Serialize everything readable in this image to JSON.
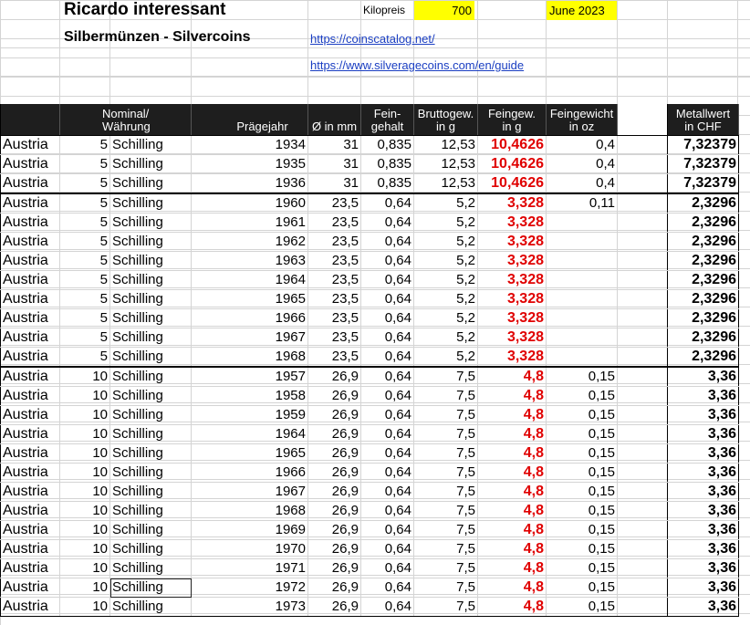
{
  "header": {
    "title": "Ricardo interessant",
    "subtitle": "Silbermünzen - Silvercoins",
    "kilopreis_label": "Kilopreis",
    "kilopreis_value": "700",
    "date": "June 2023",
    "link1": "https://coinscatalog.net/",
    "link2": "https://www.silveragecoins.com/en/guide"
  },
  "columns": {
    "c1": "",
    "c2": "Nominal/\nWährung",
    "c3": "",
    "c4": "Prägejahr",
    "c5": "Ø in mm",
    "c6": "Fein-\ngehalt",
    "c7": "Bruttogew.\nin g",
    "c8": "Feingew.\nin g",
    "c9": "Feingewicht\nin oz",
    "c10": "",
    "c11": "Metallwert\nin CHF"
  },
  "rows": [
    {
      "country": "Austria",
      "nominal": "5",
      "currency": "Schilling",
      "year": "1934",
      "diameter": "31",
      "fineness": "0,835",
      "gross": "12,53",
      "fine": "10,4626",
      "oz": "0,4",
      "value": "7,32379"
    },
    {
      "country": "Austria",
      "nominal": "5",
      "currency": "Schilling",
      "year": "1935",
      "diameter": "31",
      "fineness": "0,835",
      "gross": "12,53",
      "fine": "10,4626",
      "oz": "0,4",
      "value": "7,32379"
    },
    {
      "country": "Austria",
      "nominal": "5",
      "currency": "Schilling",
      "year": "1936",
      "diameter": "31",
      "fineness": "0,835",
      "gross": "12,53",
      "fine": "10,4626",
      "oz": "0,4",
      "value": "7,32379"
    },
    {
      "country": "Austria",
      "nominal": "5",
      "currency": "Schilling",
      "year": "1960",
      "diameter": "23,5",
      "fineness": "0,64",
      "gross": "5,2",
      "fine": "3,328",
      "oz": "0,11",
      "value": "2,3296"
    },
    {
      "country": "Austria",
      "nominal": "5",
      "currency": "Schilling",
      "year": "1961",
      "diameter": "23,5",
      "fineness": "0,64",
      "gross": "5,2",
      "fine": "3,328",
      "oz": "",
      "value": "2,3296"
    },
    {
      "country": "Austria",
      "nominal": "5",
      "currency": "Schilling",
      "year": "1962",
      "diameter": "23,5",
      "fineness": "0,64",
      "gross": "5,2",
      "fine": "3,328",
      "oz": "",
      "value": "2,3296"
    },
    {
      "country": "Austria",
      "nominal": "5",
      "currency": "Schilling",
      "year": "1963",
      "diameter": "23,5",
      "fineness": "0,64",
      "gross": "5,2",
      "fine": "3,328",
      "oz": "",
      "value": "2,3296"
    },
    {
      "country": "Austria",
      "nominal": "5",
      "currency": "Schilling",
      "year": "1964",
      "diameter": "23,5",
      "fineness": "0,64",
      "gross": "5,2",
      "fine": "3,328",
      "oz": "",
      "value": "2,3296"
    },
    {
      "country": "Austria",
      "nominal": "5",
      "currency": "Schilling",
      "year": "1965",
      "diameter": "23,5",
      "fineness": "0,64",
      "gross": "5,2",
      "fine": "3,328",
      "oz": "",
      "value": "2,3296"
    },
    {
      "country": "Austria",
      "nominal": "5",
      "currency": "Schilling",
      "year": "1966",
      "diameter": "23,5",
      "fineness": "0,64",
      "gross": "5,2",
      "fine": "3,328",
      "oz": "",
      "value": "2,3296"
    },
    {
      "country": "Austria",
      "nominal": "5",
      "currency": "Schilling",
      "year": "1967",
      "diameter": "23,5",
      "fineness": "0,64",
      "gross": "5,2",
      "fine": "3,328",
      "oz": "",
      "value": "2,3296"
    },
    {
      "country": "Austria",
      "nominal": "5",
      "currency": "Schilling",
      "year": "1968",
      "diameter": "23,5",
      "fineness": "0,64",
      "gross": "5,2",
      "fine": "3,328",
      "oz": "",
      "value": "2,3296"
    },
    {
      "country": "Austria",
      "nominal": "10",
      "currency": "Schilling",
      "year": "1957",
      "diameter": "26,9",
      "fineness": "0,64",
      "gross": "7,5",
      "fine": "4,8",
      "oz": "0,15",
      "value": "3,36"
    },
    {
      "country": "Austria",
      "nominal": "10",
      "currency": "Schilling",
      "year": "1958",
      "diameter": "26,9",
      "fineness": "0,64",
      "gross": "7,5",
      "fine": "4,8",
      "oz": "0,15",
      "value": "3,36"
    },
    {
      "country": "Austria",
      "nominal": "10",
      "currency": "Schilling",
      "year": "1959",
      "diameter": "26,9",
      "fineness": "0,64",
      "gross": "7,5",
      "fine": "4,8",
      "oz": "0,15",
      "value": "3,36"
    },
    {
      "country": "Austria",
      "nominal": "10",
      "currency": "Schilling",
      "year": "1964",
      "diameter": "26,9",
      "fineness": "0,64",
      "gross": "7,5",
      "fine": "4,8",
      "oz": "0,15",
      "value": "3,36"
    },
    {
      "country": "Austria",
      "nominal": "10",
      "currency": "Schilling",
      "year": "1965",
      "diameter": "26,9",
      "fineness": "0,64",
      "gross": "7,5",
      "fine": "4,8",
      "oz": "0,15",
      "value": "3,36"
    },
    {
      "country": "Austria",
      "nominal": "10",
      "currency": "Schilling",
      "year": "1966",
      "diameter": "26,9",
      "fineness": "0,64",
      "gross": "7,5",
      "fine": "4,8",
      "oz": "0,15",
      "value": "3,36"
    },
    {
      "country": "Austria",
      "nominal": "10",
      "currency": "Schilling",
      "year": "1967",
      "diameter": "26,9",
      "fineness": "0,64",
      "gross": "7,5",
      "fine": "4,8",
      "oz": "0,15",
      "value": "3,36"
    },
    {
      "country": "Austria",
      "nominal": "10",
      "currency": "Schilling",
      "year": "1968",
      "diameter": "26,9",
      "fineness": "0,64",
      "gross": "7,5",
      "fine": "4,8",
      "oz": "0,15",
      "value": "3,36"
    },
    {
      "country": "Austria",
      "nominal": "10",
      "currency": "Schilling",
      "year": "1969",
      "diameter": "26,9",
      "fineness": "0,64",
      "gross": "7,5",
      "fine": "4,8",
      "oz": "0,15",
      "value": "3,36"
    },
    {
      "country": "Austria",
      "nominal": "10",
      "currency": "Schilling",
      "year": "1970",
      "diameter": "26,9",
      "fineness": "0,64",
      "gross": "7,5",
      "fine": "4,8",
      "oz": "0,15",
      "value": "3,36"
    },
    {
      "country": "Austria",
      "nominal": "10",
      "currency": "Schilling",
      "year": "1971",
      "diameter": "26,9",
      "fineness": "0,64",
      "gross": "7,5",
      "fine": "4,8",
      "oz": "0,15",
      "value": "3,36"
    },
    {
      "country": "Austria",
      "nominal": "10",
      "currency": "Schilling",
      "year": "1972",
      "diameter": "26,9",
      "fineness": "0,64",
      "gross": "7,5",
      "fine": "4,8",
      "oz": "0,15",
      "value": "3,36"
    },
    {
      "country": "Austria",
      "nominal": "10",
      "currency": "Schilling",
      "year": "1973",
      "diameter": "26,9",
      "fineness": "0,64",
      "gross": "7,5",
      "fine": "4,8",
      "oz": "0,15",
      "value": "3,36"
    }
  ]
}
